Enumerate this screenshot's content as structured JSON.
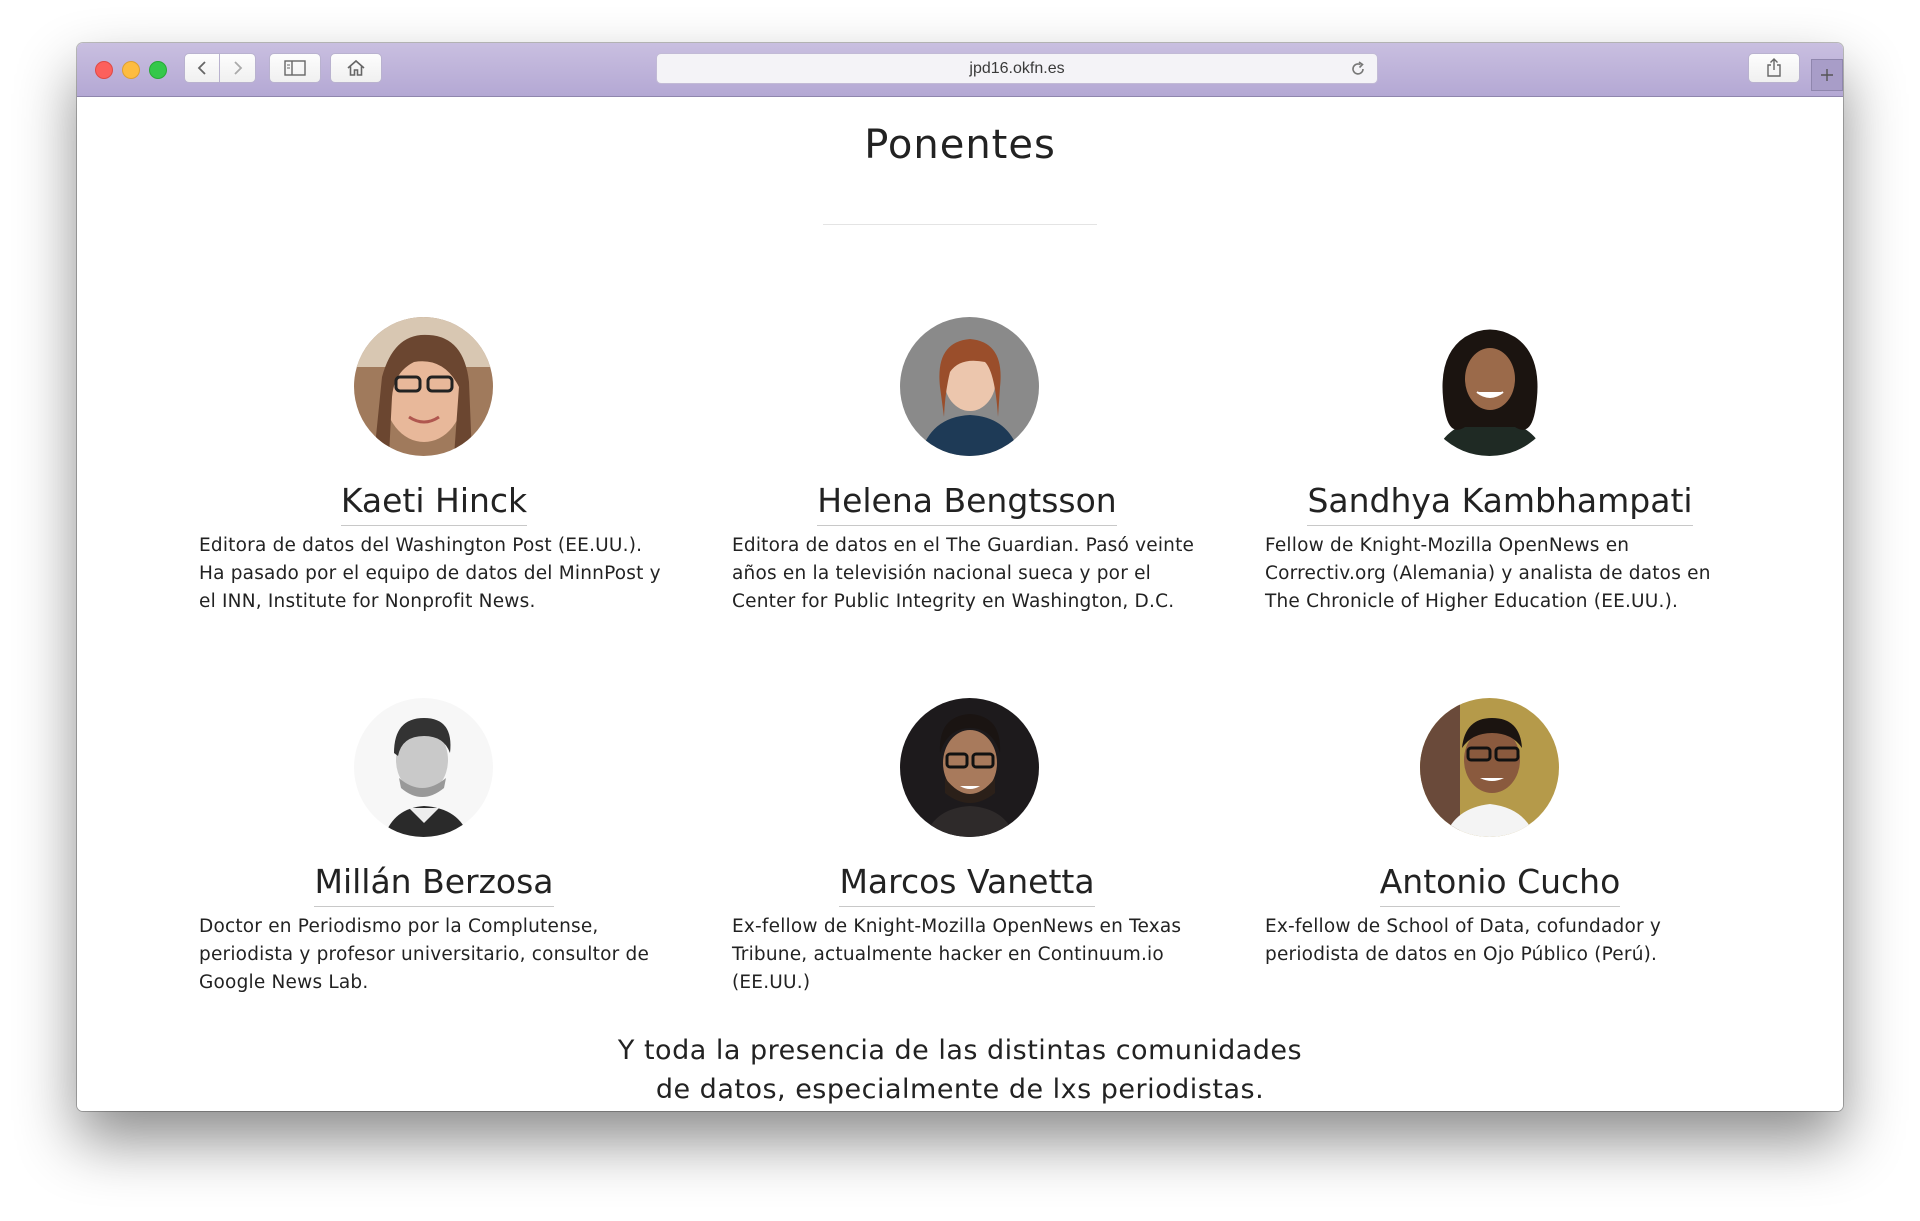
{
  "browser": {
    "url": "jpd16.okfn.es",
    "icons": {
      "back": "chevron-left-icon",
      "forward": "chevron-right-icon",
      "sidebar": "sidebar-icon",
      "home": "home-icon",
      "reload": "reload-icon",
      "share": "share-icon",
      "new_tab": "plus-icon"
    }
  },
  "page": {
    "title": "Ponentes",
    "speakers": [
      {
        "name": "Kaeti Hinck",
        "bio": "Editora de datos del Washington Post (EE.UU.). Ha pasado por el equipo de datos del MinnPost y el INN, Institute for Nonprofit News."
      },
      {
        "name": "Helena Bengtsson",
        "bio": "Editora de datos en el The Guardian. Pasó veinte años en la televisión nacional sueca y por el Center for Public Integrity en Washington, D.C."
      },
      {
        "name": "Sandhya Kambhampati",
        "bio": "Fellow de Knight-Mozilla OpenNews en Correctiv.org (Alemania) y analista de datos en The Chronicle of Higher Education (EE.UU.)."
      },
      {
        "name": "Millán Berzosa",
        "bio": "Doctor en Periodismo por la Complutense, periodista y profesor universitario, consultor de Google News Lab."
      },
      {
        "name": "Marcos Vanetta",
        "bio": "Ex-fellow de Knight-Mozilla OpenNews en Texas Tribune, actualmente hacker en Continuum.io (EE.UU.)"
      },
      {
        "name": "Antonio Cucho",
        "bio": "Ex-fellow de School of Data, cofundador y periodista de datos en Ojo Público (Perú)."
      }
    ],
    "footer_line1": "Y toda la presencia de las distintas comunidades",
    "footer_line2": "de datos, especialmente de lxs periodistas."
  },
  "colors": {
    "titlebar": "#b4a8d4",
    "text": "#222222",
    "close": "#fc605c",
    "minimize": "#fdbc40",
    "maximize": "#34c84a"
  }
}
